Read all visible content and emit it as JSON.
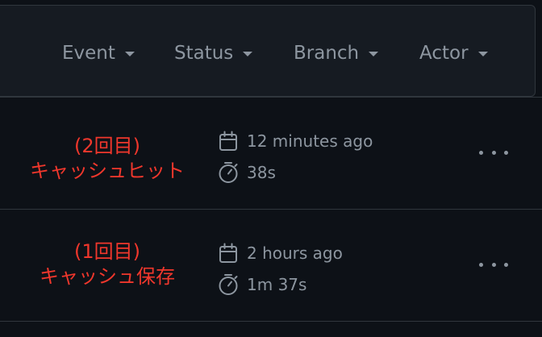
{
  "filters": [
    {
      "label": "Event"
    },
    {
      "label": "Status"
    },
    {
      "label": "Branch"
    },
    {
      "label": "Actor"
    }
  ],
  "runs": [
    {
      "annotation_line1": "(2回目)",
      "annotation_line2": "キャッシュヒット",
      "started": "12 minutes ago",
      "duration": "38s"
    },
    {
      "annotation_line1": "(1回目)",
      "annotation_line2": "キャッシュ保存",
      "started": "2 hours ago",
      "duration": "1m 37s"
    }
  ],
  "colors": {
    "background": "#0d1117",
    "header": "#161b22",
    "border": "#30363d",
    "muted_text": "#8d96a0",
    "annotation": "#f0372c"
  },
  "icons": {
    "date": "calendar-icon",
    "duration": "stopwatch-icon",
    "menu": "kebab-horizontal-icon",
    "dropdown": "triangle-down-icon"
  }
}
